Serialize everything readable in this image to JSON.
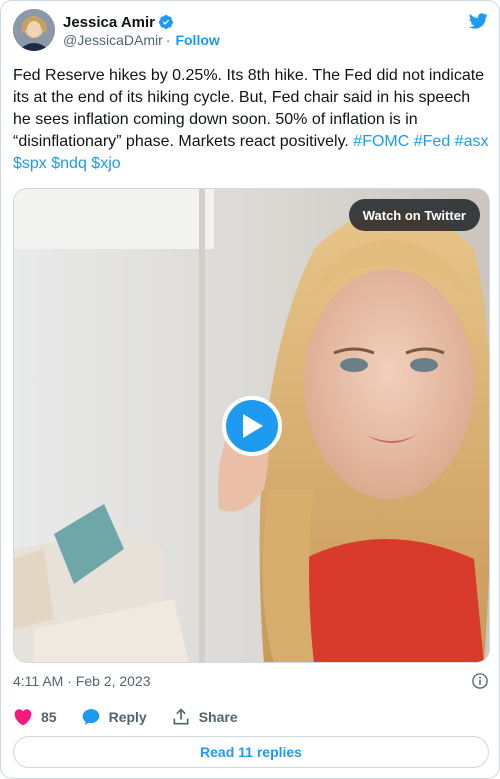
{
  "author": {
    "name": "Jessica Amir",
    "handle": "@JessicaDAmir",
    "separator": "·",
    "follow_label": "Follow"
  },
  "tweet": {
    "text": "Fed Reserve hikes by 0.25%. Its 8th hike. The Fed did not indicate its at the end of its hiking cycle. But, Fed chair said in his speech he sees inflation coming down soon. 50% of inflation is in “disinflationary” phase. Markets react positively.",
    "hashtags": [
      "#FOMC",
      "#Fed",
      "#asx",
      "$spx",
      "$ndq",
      "$xjo"
    ],
    "timestamp": "4:11 AM · Feb 2, 2023"
  },
  "media": {
    "watch_label": "Watch on Twitter"
  },
  "actions": {
    "like_count": "85",
    "reply_label": "Reply",
    "share_label": "Share"
  },
  "replies": {
    "label": "Read 11 replies"
  },
  "colors": {
    "accent": "#1d9bf0",
    "like": "#f91880",
    "muted": "#536471",
    "text": "#0f1419",
    "border": "#cfd9de"
  },
  "icons": [
    "verified-icon",
    "twitter-bird-icon",
    "play-icon",
    "info-icon",
    "heart-icon",
    "reply-icon",
    "share-icon"
  ]
}
